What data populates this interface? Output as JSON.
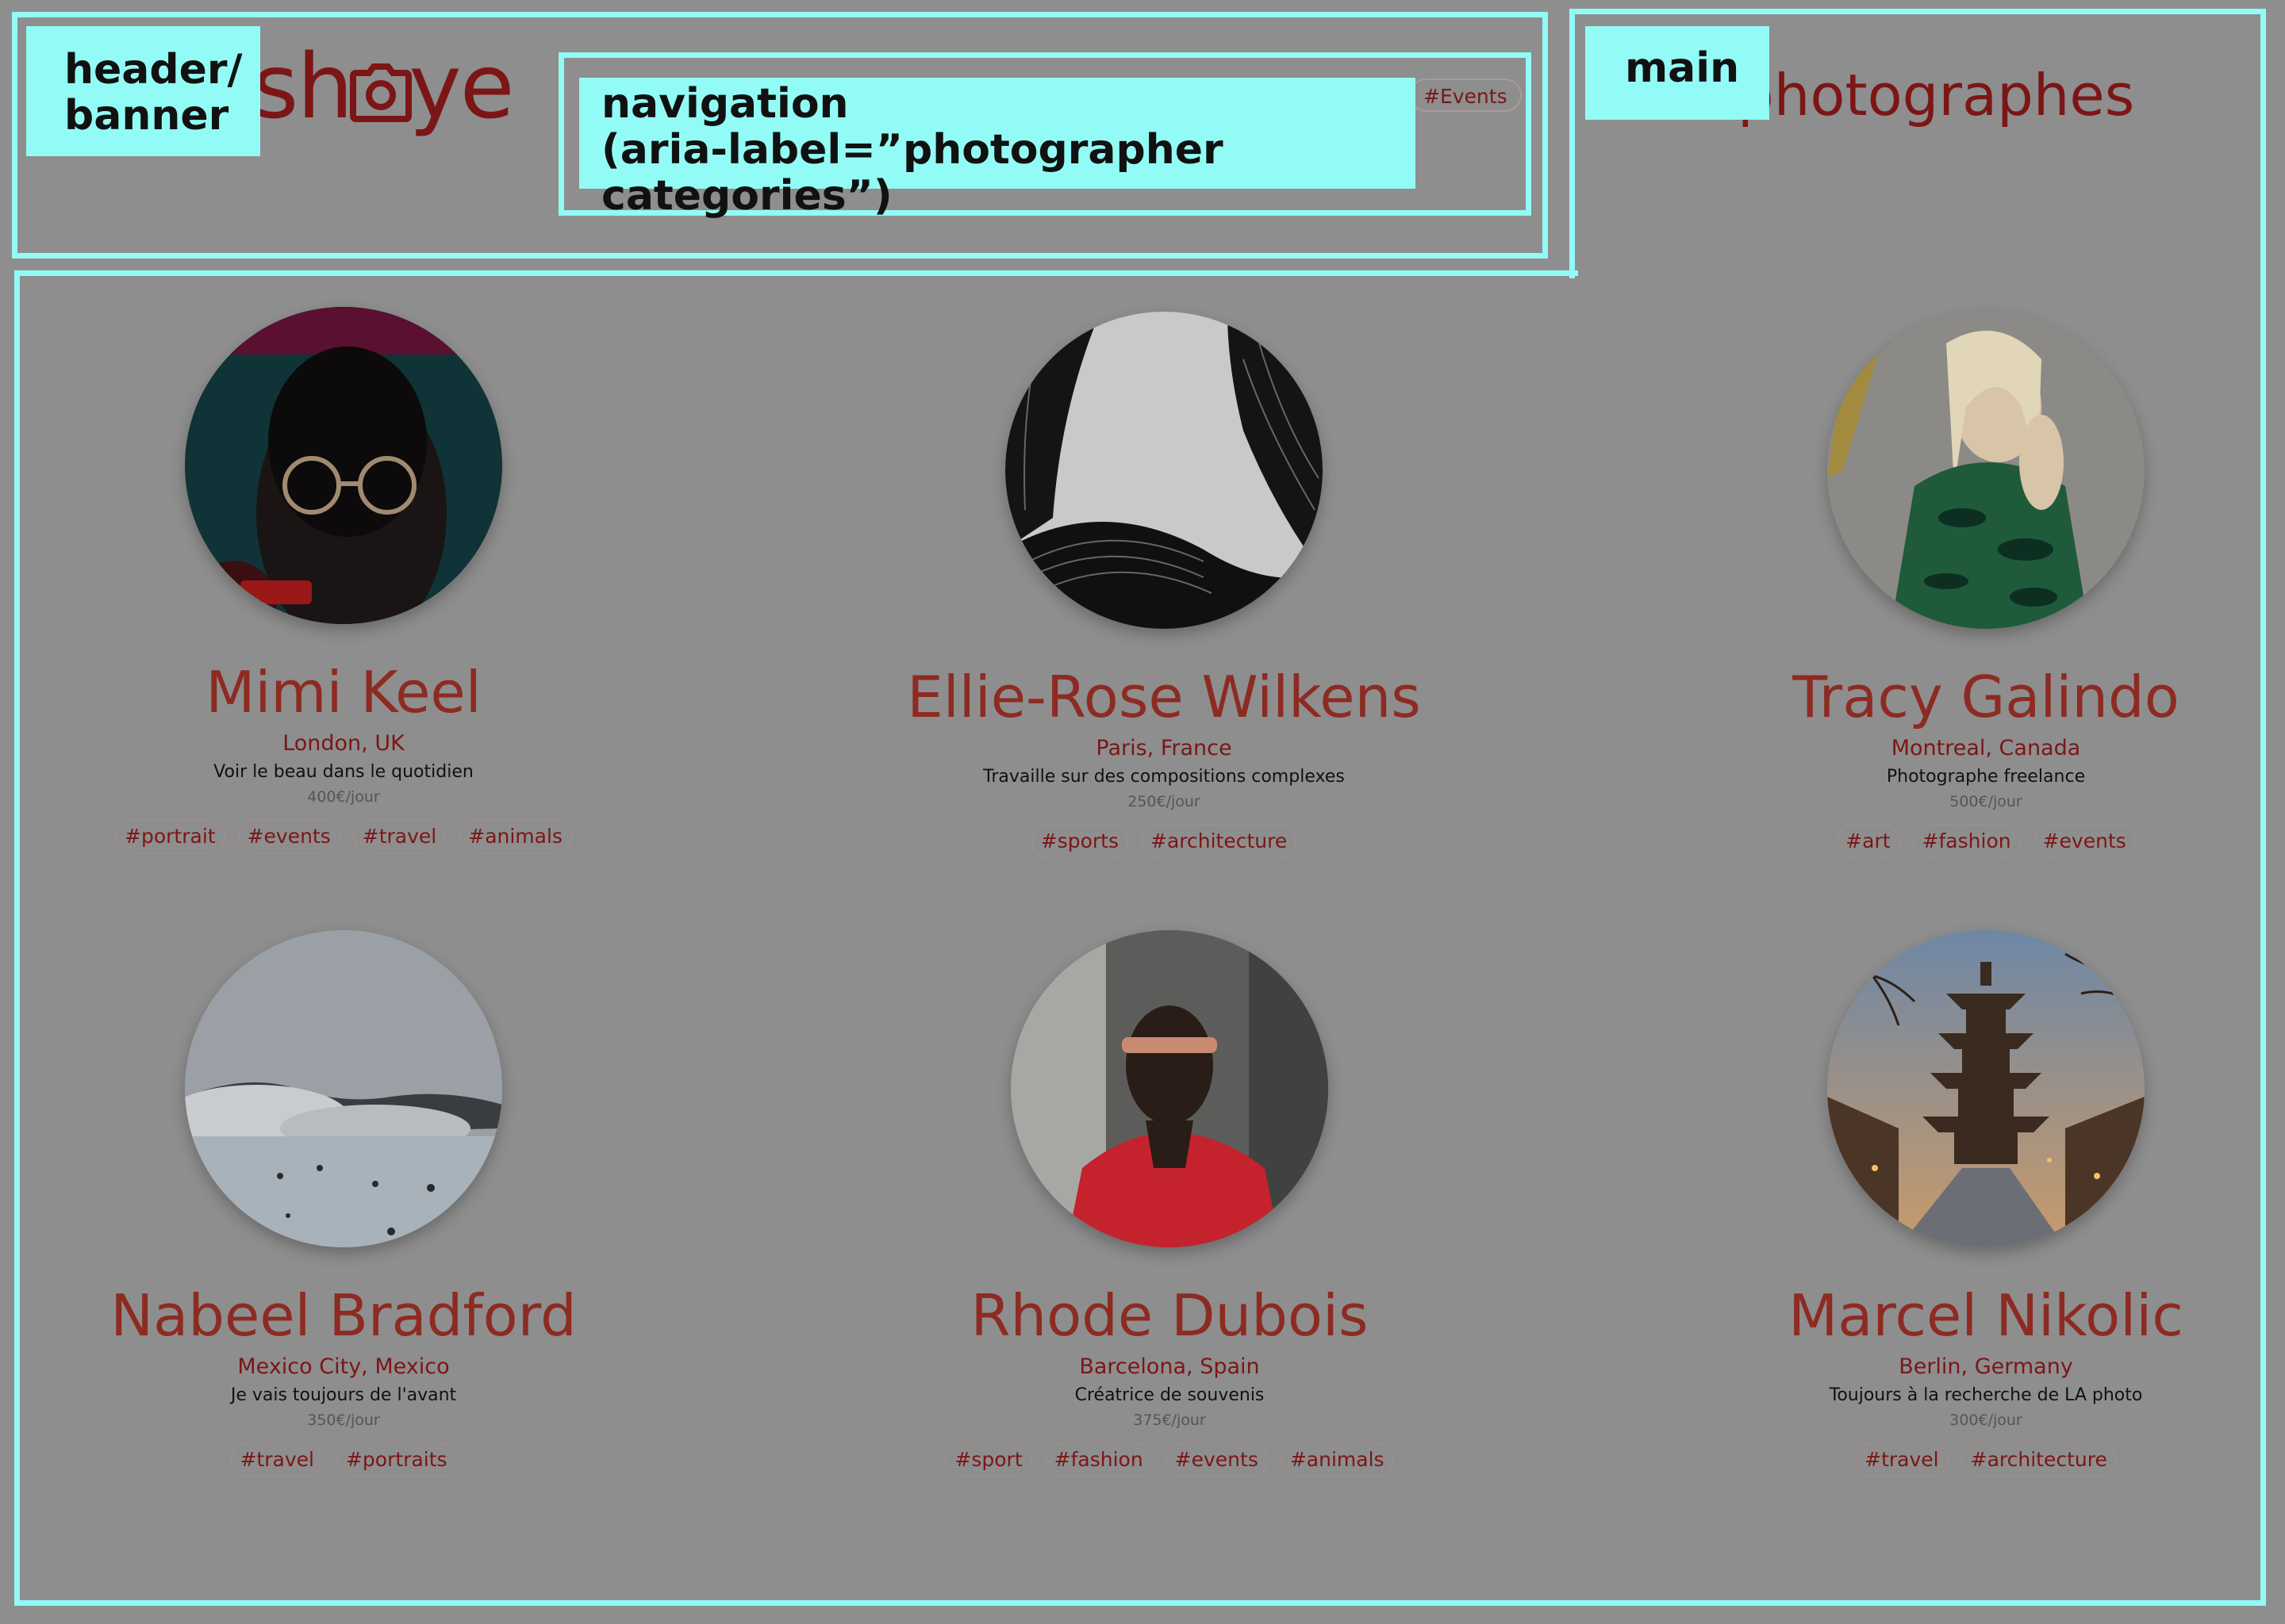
{
  "annotations": {
    "header": "header/\nbanner",
    "navigation": "navigation\n(aria-label=”photographer categories”)",
    "main": "main"
  },
  "header": {
    "logo_left": "sh",
    "logo_right": "ye",
    "logo_icon": "camera-icon",
    "nav_visible_tag": "#Events",
    "page_title": "photographes"
  },
  "colors": {
    "accent": "#7c1616",
    "name": "#8d2b22",
    "overlay_bg": "#8e8e8e",
    "annotation": "#92fbf5"
  },
  "photographers": [
    {
      "name": "Mimi Keel",
      "location": "London, UK",
      "tagline": "Voir le beau dans le quotidien",
      "price": "400€/jour",
      "tags": [
        "#portrait",
        "#events",
        "#travel",
        "#animals"
      ]
    },
    {
      "name": "Ellie-Rose Wilkens",
      "location": "Paris, France",
      "tagline": "Travaille sur des compositions complexes",
      "price": "250€/jour",
      "tags": [
        "#sports",
        "#architecture"
      ]
    },
    {
      "name": "Tracy Galindo",
      "location": "Montreal, Canada",
      "tagline": "Photographe freelance",
      "price": "500€/jour",
      "tags": [
        "#art",
        "#fashion",
        "#events"
      ]
    },
    {
      "name": "Nabeel Bradford",
      "location": "Mexico City, Mexico",
      "tagline": "Je vais toujours de l'avant",
      "price": "350€/jour",
      "tags": [
        "#travel",
        "#portraits"
      ]
    },
    {
      "name": "Rhode Dubois",
      "location": "Barcelona, Spain",
      "tagline": "Créatrice de souvenis",
      "price": "375€/jour",
      "tags": [
        "#sport",
        "#fashion",
        "#events",
        "#animals"
      ]
    },
    {
      "name": "Marcel Nikolic",
      "location": "Berlin, Germany",
      "tagline": "Toujours à la recherche de LA photo",
      "price": "300€/jour",
      "tags": [
        "#travel",
        "#architecture"
      ]
    }
  ]
}
